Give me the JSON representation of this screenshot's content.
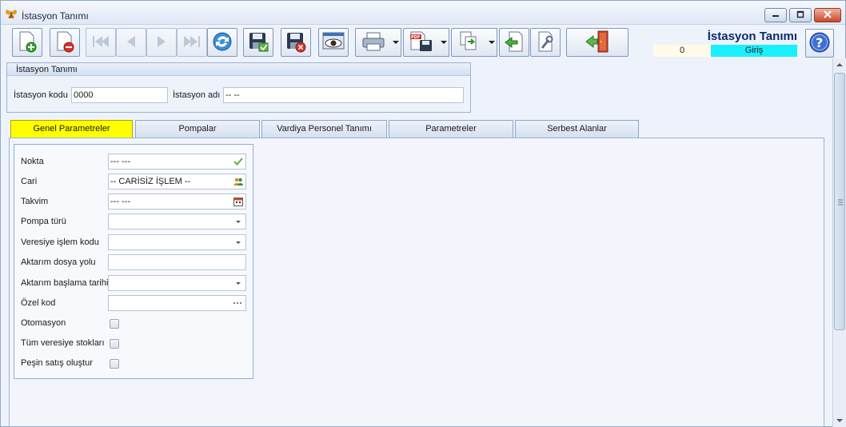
{
  "window": {
    "title": "İstasyon Tanımı",
    "icons": {
      "app": "butterfly-icon",
      "minimize": "minimize-icon",
      "maximize": "maximize-icon",
      "close": "close-icon"
    }
  },
  "toolbar": {
    "buttons": [
      {
        "icon": "new-document-icon",
        "enabled": true
      },
      {
        "icon": "delete-document-icon",
        "enabled": true
      },
      {
        "icon": "first-record-icon",
        "enabled": false
      },
      {
        "icon": "previous-record-icon",
        "enabled": false
      },
      {
        "icon": "next-record-icon",
        "enabled": false
      },
      {
        "icon": "last-record-icon",
        "enabled": false
      },
      {
        "icon": "refresh-icon",
        "enabled": true
      },
      {
        "icon": "save-icon",
        "enabled": true
      },
      {
        "icon": "save-cancel-icon",
        "enabled": true
      },
      {
        "icon": "preview-icon",
        "enabled": true
      },
      {
        "icon": "print-icon",
        "enabled": true,
        "dropdown": true
      },
      {
        "icon": "pdf-export-icon",
        "enabled": true,
        "dropdown": true
      },
      {
        "icon": "copy-transfer-icon",
        "enabled": true,
        "dropdown": true
      },
      {
        "icon": "import-icon",
        "enabled": true
      },
      {
        "icon": "tools-icon",
        "enabled": true
      },
      {
        "icon": "exit-door-icon",
        "enabled": true
      }
    ]
  },
  "header": {
    "form_title": "İstasyon Tanımı",
    "status_count": "0",
    "status_mode": "Giriş",
    "status_mode_color": "#19f0ff",
    "help_icon": "help-icon"
  },
  "station_group": {
    "title": "İstasyon Tanımı",
    "code_label": "İstasyon kodu",
    "code_value": "0000",
    "name_label": "İstasyon adı",
    "name_value": "-- --"
  },
  "tabs": [
    {
      "label": "Genel Parametreler",
      "active": true
    },
    {
      "label": "Pompalar",
      "active": false
    },
    {
      "label": "Vardiya Personel Tanımı",
      "active": false
    },
    {
      "label": "Parametreler",
      "active": false
    },
    {
      "label": "Serbest Alanlar",
      "active": false
    }
  ],
  "active_tab_color": "#ffff00",
  "general_params": {
    "nokta": {
      "label": "Nokta",
      "value": "--- ---",
      "icon": "checkmark-icon"
    },
    "cari": {
      "label": "Cari",
      "value": "-- CARİSİZ İŞLEM --",
      "icon": "people-icon"
    },
    "takvim": {
      "label": "Takvim",
      "value": "--- ---",
      "icon": "calendar-icon"
    },
    "pompa_turu": {
      "label": "Pompa türü",
      "value": ""
    },
    "veresiye_islem_kodu": {
      "label": "Veresiye işlem kodu",
      "value": ""
    },
    "aktarim_dosya_yolu": {
      "label": "Aktarım dosya yolu",
      "value": ""
    },
    "aktarim_baslama_tarihi": {
      "label": "Aktarım başlama tarihi",
      "value": " .  .       :  :"
    },
    "ozel_kod": {
      "label": "Özel kod",
      "value": "",
      "icon": "ellipsis-icon"
    },
    "otomasyon": {
      "label": "Otomasyon",
      "checked": false
    },
    "tum_veresiye_stoklari": {
      "label": "Tüm veresiye stokları",
      "checked": false
    },
    "pesin_satis_olustur": {
      "label": "Peşin satış oluştur",
      "checked": false
    }
  }
}
